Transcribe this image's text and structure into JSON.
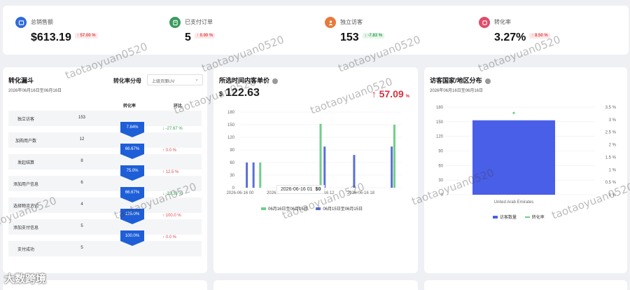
{
  "kpis": [
    {
      "label": "总销售额",
      "value": "$613.19",
      "change": "57.00 %",
      "dir": "up",
      "icon": "dollar-icon",
      "color": "#2f6bdc"
    },
    {
      "label": "已支付订单",
      "value": "5",
      "change": "0.00 %",
      "dir": "up",
      "icon": "order-icon",
      "color": "#3a9b5c"
    },
    {
      "label": "独立访客",
      "value": "153",
      "change": "-7.83 %",
      "dir": "down",
      "icon": "user-icon",
      "color": "#e8793b"
    },
    {
      "label": "转化率",
      "value": "3.27%",
      "change": "8.50 %",
      "dir": "up",
      "icon": "refresh-icon",
      "color": "#e04c6a"
    }
  ],
  "funnel": {
    "title": "转化漏斗",
    "date_range": "2026年06月16日至06月16日",
    "select_label": "转化率分母",
    "select_value": "上级页面UV",
    "col_rate": "转化率",
    "col_chain": "环比",
    "rows": [
      {
        "name": "独立访客",
        "value": "153"
      },
      {
        "name": "加购用户数",
        "value": "12"
      },
      {
        "name": "发起结算",
        "value": "8"
      },
      {
        "name": "添加用户信息",
        "value": "6"
      },
      {
        "name": "选择物流方式",
        "value": "4"
      },
      {
        "name": "添加支付信息",
        "value": "5"
      },
      {
        "name": "支付成功",
        "value": "5"
      }
    ],
    "steps": [
      {
        "rate": "7.84%",
        "chg": "-27.67 %",
        "dir": "down"
      },
      {
        "rate": "66.67%",
        "chg": "0.0 %",
        "dir": "up"
      },
      {
        "rate": "75.0%",
        "chg": "12.5 %",
        "dir": "up"
      },
      {
        "rate": "66.67%",
        "chg": "-33.33 %",
        "dir": "down"
      },
      {
        "rate": "125.0%",
        "chg": "100.0 %",
        "dir": "up"
      },
      {
        "rate": "100.0%",
        "chg": "0.0 %",
        "dir": "up"
      }
    ]
  },
  "aov": {
    "title": "所选时间内客单价",
    "currency": "$",
    "value": "122.63",
    "change": "57.09",
    "change_unit": "%",
    "tooltip_label": "2026-06-16 01",
    "tooltip_value": "$0",
    "legend": [
      "06月16日至06月16日",
      "06月15日至06月15日"
    ]
  },
  "geo": {
    "title": "访客国家/地区分布",
    "date_range": "2026年06月16日至06月16日",
    "legend": [
      "访客数量",
      "转化率"
    ]
  },
  "chart_data": [
    {
      "type": "bar",
      "title": "所选时间内客单价",
      "x_ticks": [
        "2026-06-16 00",
        "2026-06-16 06",
        "2026-06-16 12",
        "2026-06-16 18"
      ],
      "ylim": [
        0,
        180
      ],
      "y_ticks": [
        0,
        30,
        60,
        90,
        120,
        150,
        180
      ],
      "series": [
        {
          "name": "06月16日至06月16日",
          "color": "#6fcf8a",
          "values": [
            {
              "h": 3,
              "v": 60
            },
            {
              "h": 12,
              "v": 152
            },
            {
              "h": 23,
              "v": 150
            }
          ]
        },
        {
          "name": "06月15日至06月15日",
          "color": "#5a6fd6",
          "values": [
            {
              "h": 1,
              "v": 60
            },
            {
              "h": 2,
              "v": 60
            },
            {
              "h": 12.6,
              "v": 98
            },
            {
              "h": 17,
              "v": 78
            },
            {
              "h": 22.6,
              "v": 98
            }
          ]
        }
      ],
      "legend": "bottom"
    },
    {
      "type": "bar",
      "title": "访客国家/地区分布",
      "categories": [
        "United Arab Emirates"
      ],
      "series": [
        {
          "name": "访客数量",
          "color": "#4a5fe8",
          "values": [
            153
          ]
        },
        {
          "name": "转化率",
          "color": "#6fcf8a",
          "values": [
            3.27
          ]
        }
      ],
      "y_left": [
        0,
        30,
        60,
        90,
        120,
        150,
        180
      ],
      "y_right": [
        "0 %",
        "0.5 %",
        "1 %",
        "1.5 %",
        "2 %",
        "2.5 %",
        "3 %",
        "3.5 %"
      ],
      "legend": "bottom"
    }
  ],
  "watermark": "taotaoyuan0520",
  "brand": "大数跨境"
}
